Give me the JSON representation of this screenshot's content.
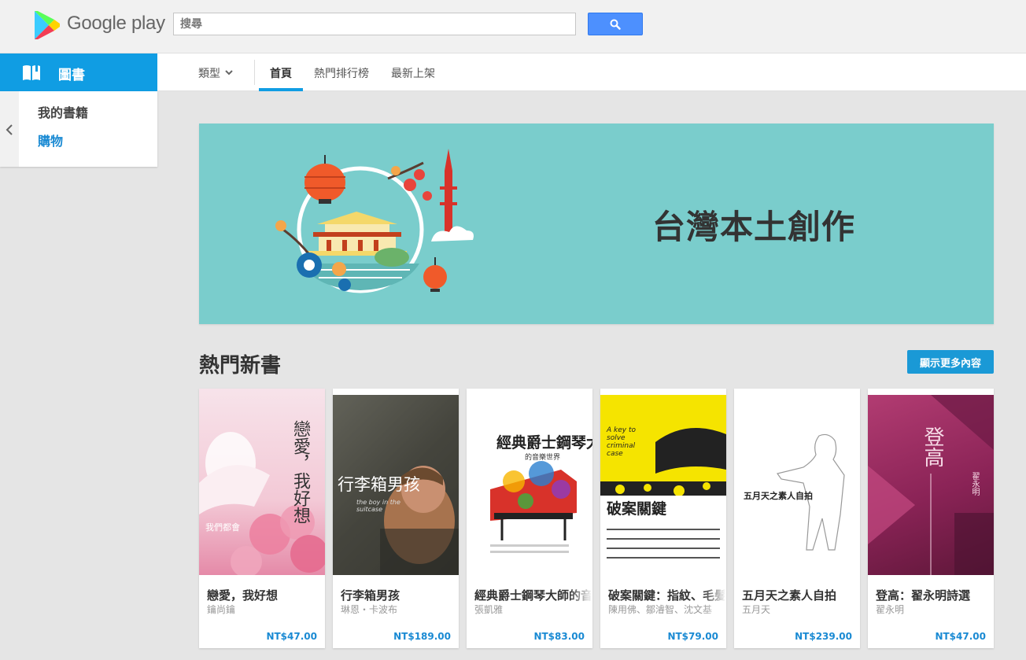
{
  "header": {
    "logo_text": "Google play",
    "search_placeholder": "搜尋"
  },
  "sidebar": {
    "section_label": "圖書",
    "items": [
      {
        "label": "我的書籍",
        "active": false
      },
      {
        "label": "購物",
        "active": true
      }
    ]
  },
  "nav": {
    "category_label": "類型",
    "tabs": [
      {
        "label": "首頁",
        "active": true
      },
      {
        "label": "熱門排行榜",
        "active": false
      },
      {
        "label": "最新上架",
        "active": false
      }
    ]
  },
  "banner": {
    "title": "台灣本土創作",
    "background_color": "#7acdcc"
  },
  "section": {
    "title": "熱門新書",
    "more_label": "顯示更多內容"
  },
  "books": [
    {
      "title": "戀愛，我好想",
      "author": "鑰尚鑰",
      "price": "NT$47.00",
      "cover_title": "戀愛，我好想",
      "cover_sub": "我們都會"
    },
    {
      "title": "行李箱男孩",
      "author": "琳恩・卡波布",
      "price": "NT$189.00",
      "cover_title": "行李箱男孩",
      "cover_sub": "the boy in the suitcase"
    },
    {
      "title": "經典爵士鋼琴大師的音樂世界",
      "author": "張凱雅",
      "price": "NT$83.00",
      "cover_title": "經典爵士鋼琴大師",
      "cover_sub": "的音樂世界"
    },
    {
      "title": "破案關鍵：指紋、毛髮、血跡、DNA",
      "author": "陳用佛、鄒濬智、沈文基",
      "price": "NT$79.00",
      "cover_title": "破案關鍵",
      "cover_sub": "A key to solve criminal case"
    },
    {
      "title": "五月天之素人自拍",
      "author": "五月天",
      "price": "NT$239.00",
      "cover_title": "五月天之素人自拍",
      "cover_sub": ""
    },
    {
      "title": "登高：翟永明詩選",
      "author": "翟永明",
      "price": "NT$47.00",
      "cover_title": "登高",
      "cover_sub": "翟永明"
    }
  ]
}
